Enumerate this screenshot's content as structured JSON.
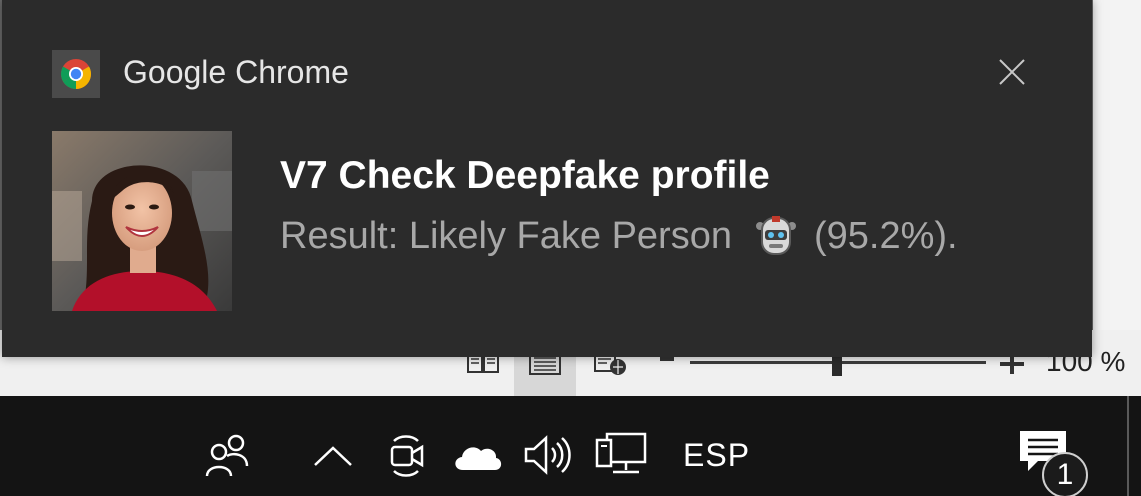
{
  "toast": {
    "app_name": "Google Chrome",
    "title": "V7 Check Deepfake profile",
    "body_prefix": "Result: Likely Fake Person",
    "body_suffix": "(95.2%).",
    "app_icon": "chrome-icon",
    "image": "profile-photo",
    "emoji": "robot-face-icon",
    "close_icon": "close-icon"
  },
  "statusbar": {
    "zoom_label": "100 %",
    "zoom_percent": 100,
    "views": [
      "read-mode-icon",
      "print-layout-icon",
      "web-layout-icon"
    ]
  },
  "taskbar": {
    "language": "ESP",
    "notification_count": "1",
    "icons": [
      "people-icon",
      "show-hidden-icons-chevron",
      "meet-now-icon",
      "onedrive-cloud-icon",
      "volume-icon",
      "network-icon",
      "action-center-icon"
    ]
  },
  "colors": {
    "toast_bg": "#2b2b2b",
    "taskbar_bg": "#141414",
    "title": "#ffffff",
    "body": "#a8a8a8"
  }
}
